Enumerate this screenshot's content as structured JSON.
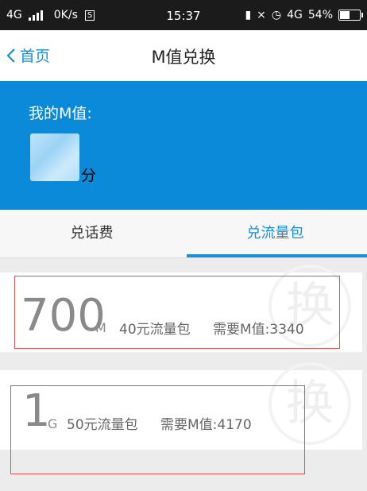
{
  "status_bar": {
    "network": "4G",
    "speed": "0K/s",
    "speed_badge": "S",
    "time": "15:37",
    "network_right": "4G",
    "battery": "54%"
  },
  "nav": {
    "back_label": "首页",
    "title": "M值兑换"
  },
  "balance": {
    "label": "我的M值:",
    "unit": "分"
  },
  "tabs": [
    {
      "label": "兑话费",
      "active": false
    },
    {
      "label": "兑流量包",
      "active": true
    }
  ],
  "packages": [
    {
      "amount": "700",
      "unit": "M",
      "price_desc": "40元流量包",
      "cost": "需要M值:3340",
      "stamp": "换"
    },
    {
      "amount": "1",
      "unit": "G",
      "price_desc": "50元流量包",
      "cost": "需要M值:4170",
      "stamp": "换"
    }
  ],
  "colors": {
    "accent": "#1a8fd6",
    "banner": "#0a8ad8",
    "annotation": "#d9534f"
  }
}
